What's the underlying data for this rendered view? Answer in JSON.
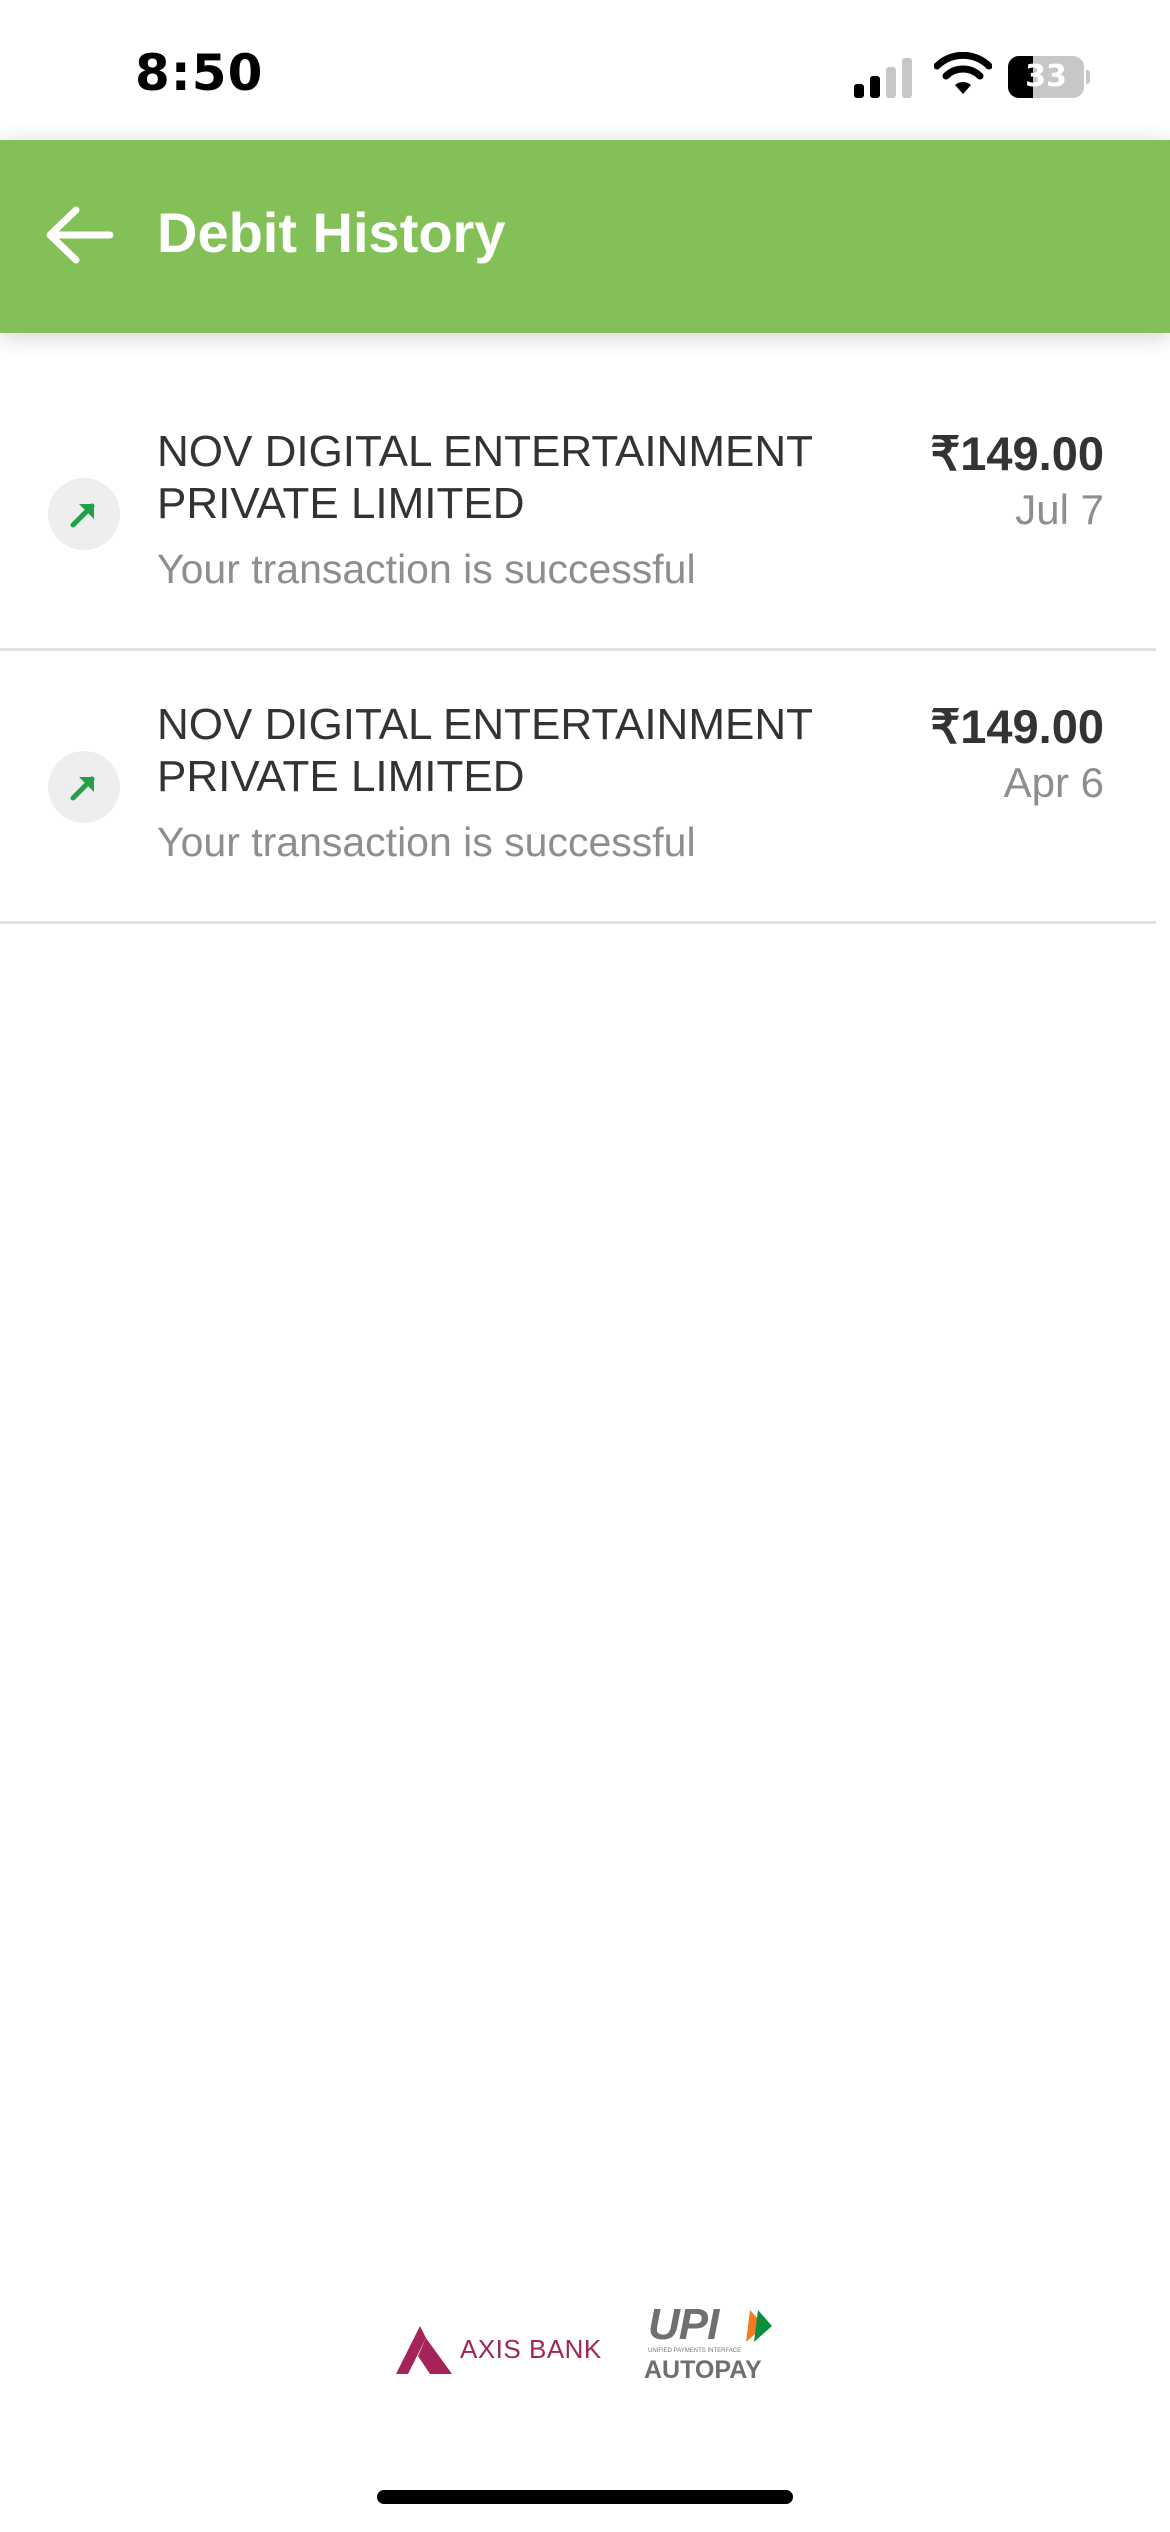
{
  "status_bar": {
    "time": "8:50",
    "battery_level": "33",
    "battery_fraction": 0.33,
    "signal_bars_active": 2,
    "signal_bars_total": 4
  },
  "header": {
    "title": "Debit History",
    "background_color": "#83c058",
    "back_icon": "arrow-left-icon"
  },
  "transactions": [
    {
      "merchant": "NOV DIGITAL ENTERTAINMENT PRIVATE LIMITED",
      "status": "Your transaction is successful",
      "amount": "₹149.00",
      "date": "Jul 7",
      "icon": "arrow-up-right-icon",
      "icon_color": "#22a046"
    },
    {
      "merchant": "NOV DIGITAL ENTERTAINMENT PRIVATE LIMITED",
      "status": "Your transaction is successful",
      "amount": "₹149.00",
      "date": "Apr 6",
      "icon": "arrow-up-right-icon",
      "icon_color": "#22a046"
    }
  ],
  "footer": {
    "bank_name": "AXIS BANK",
    "bank_color": "#a4245a",
    "upi_brand": "UPI",
    "upi_subtitle": "UNIFIED PAYMENTS INTERFACE",
    "autopay_label": "AUTOPAY"
  }
}
